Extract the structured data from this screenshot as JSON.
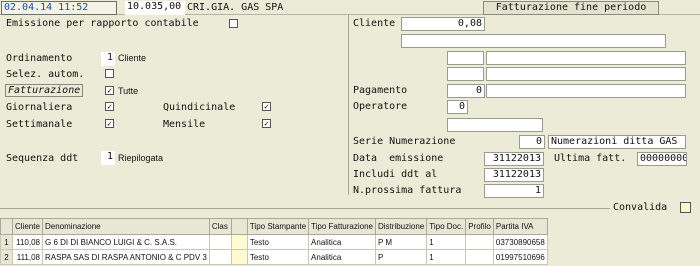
{
  "topbar": {
    "datetime": "02.04.14 11:52",
    "amount": "10.035,00",
    "company": "CRI.GIA. GAS SPA",
    "tab_label": "Fatturazione fine periodo"
  },
  "left": {
    "emissione_label": "Emissione per rapporto contabile",
    "ordinamento_label": "Ordinamento",
    "ordinamento_value": "1",
    "ordinamento_text": "Cliente",
    "selez_label": "Selez. autom.",
    "fatturazione_label": "Fatturazione",
    "tutte_label": "Tutte",
    "giornaliera_label": "Giornaliera",
    "quindicinale_label": "Quindicinale",
    "settimanale_label": "Settimanale",
    "mensile_label": "Mensile",
    "sequenza_label": "Sequenza ddt",
    "sequenza_value": "1",
    "sequenza_text": "Riepilogata"
  },
  "right": {
    "cliente_label": "Cliente",
    "cliente_value": "0,08",
    "pagamento_label": "Pagamento",
    "pagamento_value": "0",
    "operatore_label": "Operatore",
    "operatore_value": "0",
    "serie_label": "Serie Numerazione",
    "serie_value": "0",
    "serie_text": "Numerazioni ditta GAS",
    "data_label": "Data  emissione",
    "data_value": "31122013",
    "ultima_label": "Ultima fatt.",
    "ultima_value": "00000000",
    "includi_label": "Includi ddt al",
    "includi_value": "31122013",
    "nprossima_label": "N.prossima fattura",
    "nprossima_value": "1",
    "convalida_label": "Convalida"
  },
  "table": {
    "headers": [
      "Cliente",
      "Denominazione",
      "Clas",
      "",
      "Tipo Stampante",
      "Tipo Fatturazione",
      "Distribuzione",
      "Tipo Doc.",
      "Profilo",
      "Partita IVA"
    ],
    "rows": [
      {
        "n": "1",
        "cliente": "110,08",
        "denominazione": "G 6 DI DI BIANCO LUIGI & C. S.A.S.",
        "clas": "",
        "stampante": "Testo",
        "fatturazione": "Analitica",
        "distribuzione": "P M",
        "tipodoc": "1",
        "profilo": "",
        "piva": "03730890658"
      },
      {
        "n": "2",
        "cliente": "111,08",
        "denominazione": "RASPA SAS DI RASPA ANTONIO & C PDV 3",
        "clas": "",
        "stampante": "Testo",
        "fatturazione": "Analitica",
        "distribuzione": "P",
        "tipodoc": "1",
        "profilo": "",
        "piva": "01997510696"
      }
    ]
  }
}
